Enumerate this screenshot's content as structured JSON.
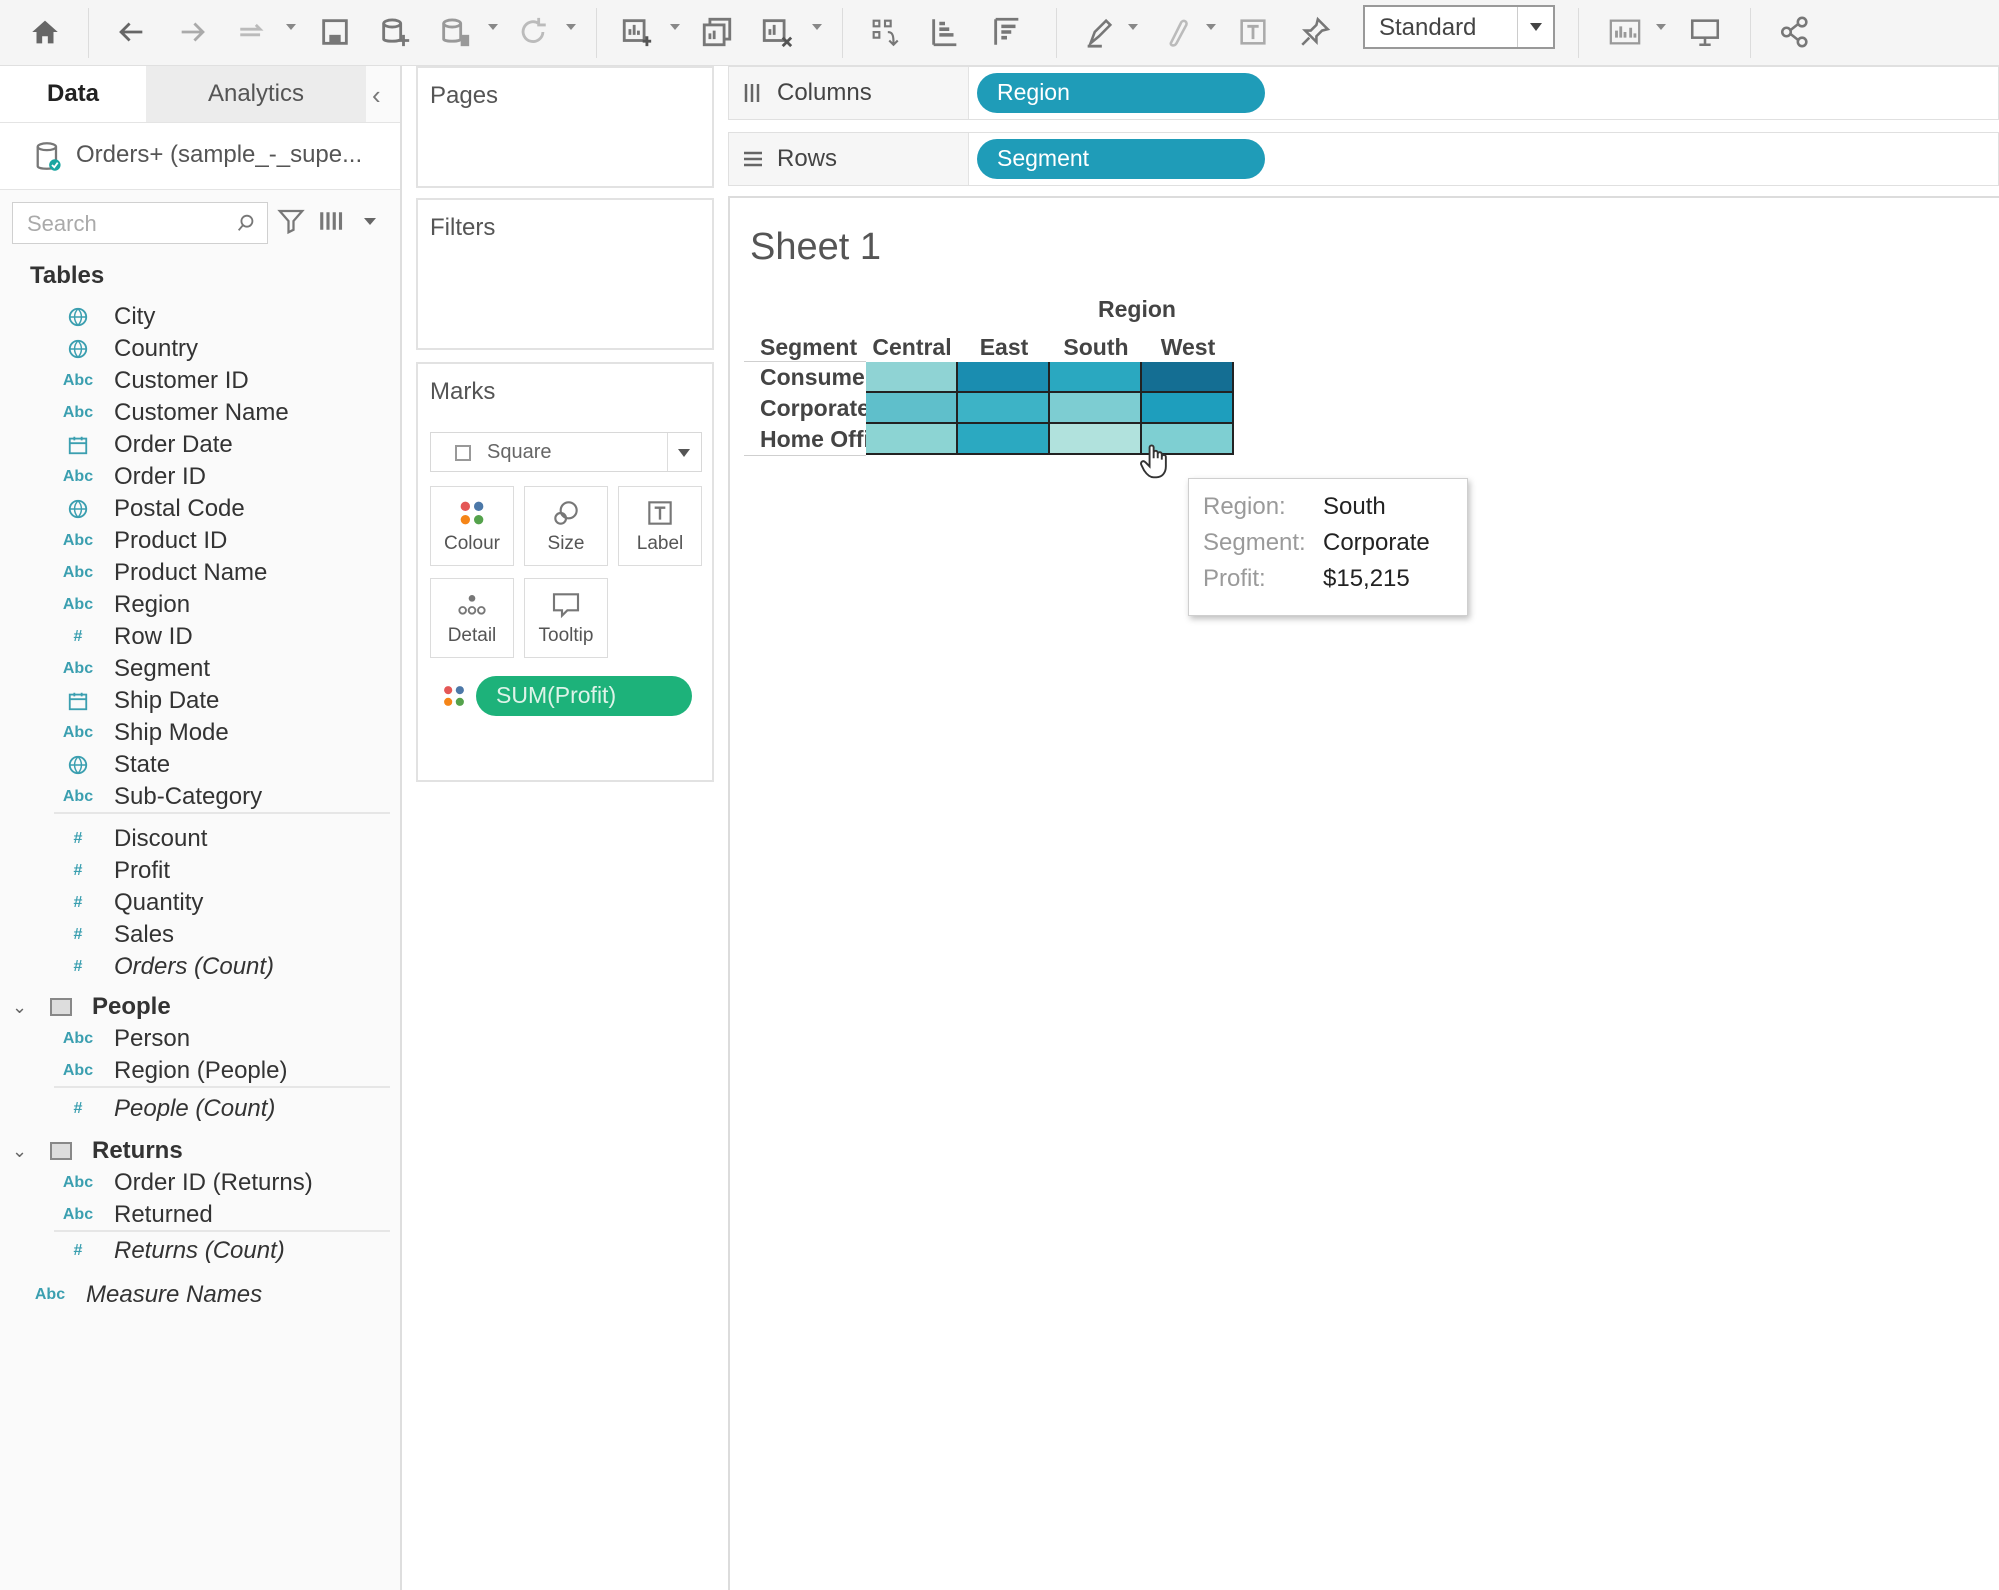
{
  "toolbar": {
    "standard_select": "Standard"
  },
  "data_pane": {
    "tab_data": "Data",
    "tab_analytics": "Analytics",
    "data_source": "Orders+ (sample_-_supe...",
    "search_placeholder": "Search",
    "tables_heading": "Tables",
    "fields": [
      {
        "name": "City",
        "type": "geo"
      },
      {
        "name": "Country",
        "type": "geo"
      },
      {
        "name": "Customer ID",
        "type": "Abc"
      },
      {
        "name": "Customer Name",
        "type": "Abc"
      },
      {
        "name": "Order Date",
        "type": "date"
      },
      {
        "name": "Order ID",
        "type": "Abc"
      },
      {
        "name": "Postal Code",
        "type": "geo"
      },
      {
        "name": "Product ID",
        "type": "Abc"
      },
      {
        "name": "Product Name",
        "type": "Abc"
      },
      {
        "name": "Region",
        "type": "Abc"
      },
      {
        "name": "Row ID",
        "type": "#"
      },
      {
        "name": "Segment",
        "type": "Abc"
      },
      {
        "name": "Ship Date",
        "type": "date"
      },
      {
        "name": "Ship Mode",
        "type": "Abc"
      },
      {
        "name": "State",
        "type": "geo"
      },
      {
        "name": "Sub-Category",
        "type": "Abc"
      }
    ],
    "measures": [
      {
        "name": "Discount",
        "type": "#"
      },
      {
        "name": "Profit",
        "type": "#"
      },
      {
        "name": "Quantity",
        "type": "#"
      },
      {
        "name": "Sales",
        "type": "#"
      },
      {
        "name": "Orders (Count)",
        "type": "#"
      }
    ],
    "people_group": "People",
    "people_fields": [
      {
        "name": "Person",
        "type": "Abc"
      },
      {
        "name": "Region (People)",
        "type": "Abc"
      },
      {
        "name": "People (Count)",
        "type": "#"
      }
    ],
    "returns_group": "Returns",
    "returns_fields": [
      {
        "name": "Order ID (Returns)",
        "type": "Abc"
      },
      {
        "name": "Returned",
        "type": "Abc"
      },
      {
        "name": "Returns (Count)",
        "type": "#"
      }
    ],
    "measure_names": {
      "name": "Measure Names",
      "type": "Abc"
    }
  },
  "cards": {
    "pages": "Pages",
    "filters": "Filters",
    "marks": "Marks",
    "mark_type": "Square",
    "mark_buttons": [
      "Colour",
      "Size",
      "Label",
      "Detail",
      "Tooltip"
    ],
    "color_pill": "SUM(Profit)"
  },
  "shelves": {
    "columns_label": "Columns",
    "columns_pill": "Region",
    "rows_label": "Rows",
    "rows_pill": "Segment"
  },
  "view": {
    "sheet_title": "Sheet 1",
    "column_header_title": "Region",
    "row_header_title": "Segment",
    "columns": [
      "Central",
      "East",
      "South",
      "West"
    ],
    "rows": [
      "Consumer",
      "Corporate",
      "Home Office"
    ],
    "cell_colors": [
      [
        "#8fd3d4",
        "#1a8db0",
        "#2aa8c0",
        "#146e93"
      ],
      [
        "#5fbfcb",
        "#3db3c6",
        "#7dcdd2",
        "#1e9ebd"
      ],
      [
        "#8cd4d3",
        "#2ba9c1",
        "#b1e2dd",
        "#7ecfd2"
      ]
    ],
    "tooltip": {
      "region_key": "Region:",
      "region_val": "South",
      "segment_key": "Segment:",
      "segment_val": "Corporate",
      "profit_key": "Profit:",
      "profit_val": "$15,215"
    }
  }
}
